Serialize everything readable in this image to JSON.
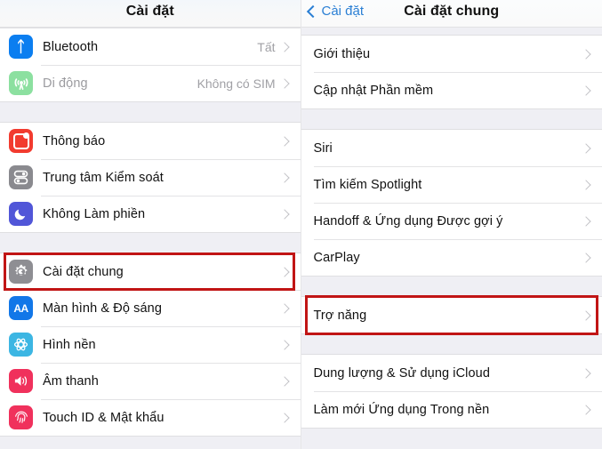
{
  "left_panel": {
    "navbar": {
      "title": "Cài đặt"
    },
    "groups": [
      {
        "rows": [
          {
            "label": "Bluetooth",
            "value": "Tất",
            "icon": "bluetooth-icon",
            "dim": false
          },
          {
            "label": "Di động",
            "value": "Không có SIM",
            "icon": "cellular-icon",
            "dim": true
          }
        ]
      },
      {
        "rows": [
          {
            "label": "Thông báo",
            "value": "",
            "icon": "notifications-icon",
            "dim": false
          },
          {
            "label": "Trung tâm Kiểm soát",
            "value": "",
            "icon": "control-center-icon",
            "dim": false
          },
          {
            "label": "Không Làm phiền",
            "value": "",
            "icon": "do-not-disturb-moon-icon",
            "dim": false
          }
        ]
      },
      {
        "rows": [
          {
            "label": "Cài đặt chung",
            "value": "",
            "icon": "gear-icon",
            "dim": false,
            "highlighted": true
          },
          {
            "label": "Màn hình & Độ sáng",
            "value": "",
            "icon": "display-brightness-icon",
            "dim": false
          },
          {
            "label": "Hình nền",
            "value": "",
            "icon": "wallpaper-icon",
            "dim": false
          },
          {
            "label": "Âm thanh",
            "value": "",
            "icon": "sound-speaker-icon",
            "dim": false
          },
          {
            "label": "Touch ID & Mật khẩu",
            "value": "",
            "icon": "touch-id-fingerprint-icon",
            "dim": false
          }
        ]
      }
    ]
  },
  "right_panel": {
    "navbar": {
      "back_label": "Cài đặt",
      "title": "Cài đặt chung"
    },
    "groups": [
      {
        "rows": [
          {
            "label": "Giới thiệu"
          },
          {
            "label": "Cập nhật Phần mềm"
          }
        ]
      },
      {
        "rows": [
          {
            "label": "Siri"
          },
          {
            "label": "Tìm kiếm Spotlight"
          },
          {
            "label": "Handoff & Ứng dụng Được gợi ý"
          },
          {
            "label": "CarPlay"
          }
        ]
      },
      {
        "rows": [
          {
            "label": "Trợ năng",
            "highlighted": true
          }
        ]
      },
      {
        "rows": [
          {
            "label": "Dung lượng & Sử dụng iCloud"
          },
          {
            "label": "Làm mới Ứng dụng Trong nền"
          }
        ]
      }
    ]
  },
  "colors": {
    "accent_blue": "#2a7fd4",
    "highlight_red": "#c11515",
    "list_background": "#efeff4",
    "row_background": "#ffffff",
    "separator": "#e3e3e5",
    "chevron": "#c2c2c6",
    "secondary_text": "#a0a0a5"
  }
}
